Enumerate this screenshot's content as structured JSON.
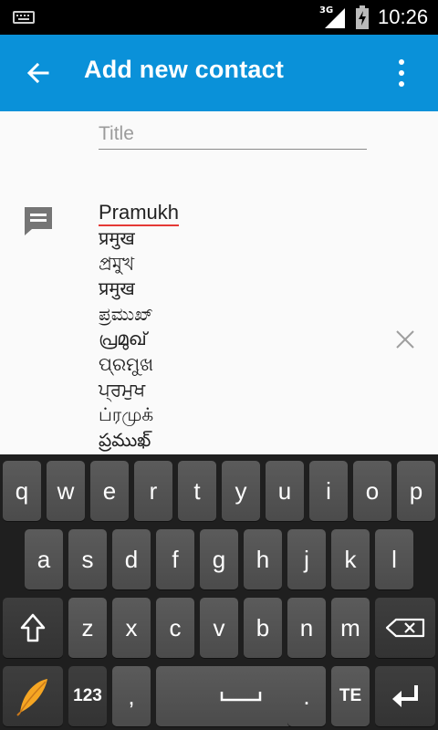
{
  "status_bar": {
    "network_type": "3G",
    "time": "10:26",
    "icons": [
      "keyboard-icon",
      "signal-icon",
      "battery-charging-icon"
    ]
  },
  "toolbar": {
    "title": "Add new contact",
    "icons": [
      "back-arrow-icon",
      "overflow-menu-icon"
    ],
    "color": "#0a91d9"
  },
  "form": {
    "title_placeholder": "Title",
    "title_value": "",
    "notes_composing_word": "Pramukh",
    "notes_icon": "notes-icon",
    "clear_icon": "clear-icon",
    "suggestions": [
      "प्रमुख",
      "প্ৰমুখ",
      "प्रमुख",
      "ಪ್ರಮುಖ್",
      "പ്രമുഖ്",
      "ପ୍ରମୁଖ",
      "ਪ੍ਰਮੁਖ",
      "ப்ரமுக்",
      "ప్రముఖ్"
    ],
    "accent_color": "#e53935"
  },
  "keyboard": {
    "row1": [
      "q",
      "w",
      "e",
      "r",
      "t",
      "y",
      "u",
      "i",
      "o",
      "p"
    ],
    "row2": [
      "a",
      "s",
      "d",
      "f",
      "g",
      "h",
      "j",
      "k",
      "l"
    ],
    "row3": [
      "z",
      "x",
      "c",
      "v",
      "b",
      "n",
      "m"
    ],
    "numbers_label": "123",
    "comma_label": ",",
    "period_label": ".",
    "language_label": "TE",
    "special_icons": [
      "shift-icon",
      "backspace-icon",
      "pramukh-logo-icon",
      "spacebar-icon",
      "enter-icon"
    ]
  }
}
